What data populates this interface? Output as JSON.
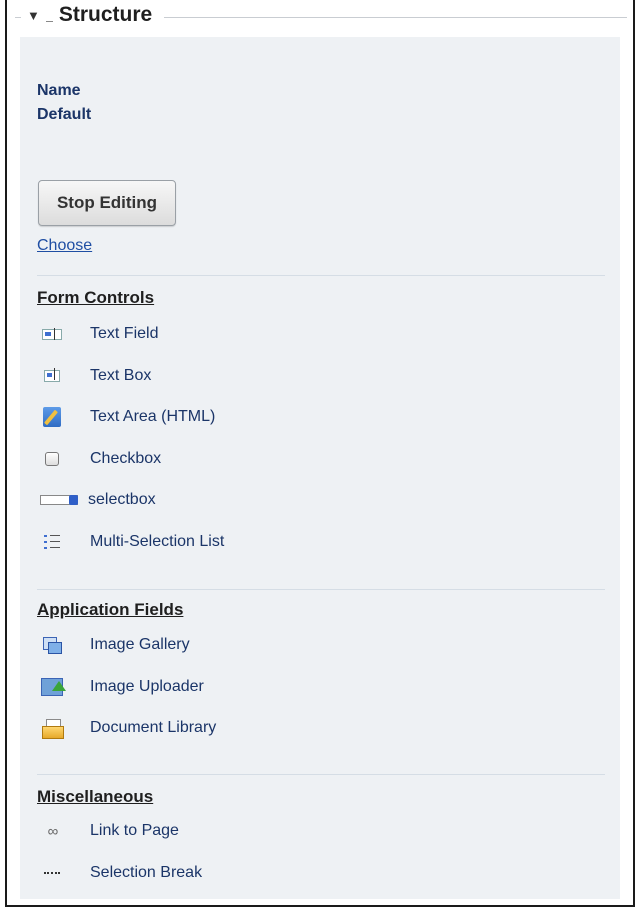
{
  "header": {
    "collapse_glyph": "▼",
    "title": "Structure"
  },
  "meta": {
    "name_label": "Name",
    "default_label": "Default"
  },
  "actions": {
    "stop_editing": "Stop Editing",
    "choose": "Choose"
  },
  "sections": {
    "form_controls": {
      "title": "Form Controls",
      "items": [
        {
          "label": "Text Field",
          "icon": "text-field-icon"
        },
        {
          "label": "Text Box",
          "icon": "text-box-icon"
        },
        {
          "label": "Text Area (HTML)",
          "icon": "text-area-icon"
        },
        {
          "label": "Checkbox",
          "icon": "checkbox-icon"
        },
        {
          "label": "selectbox",
          "icon": "selectbox-icon"
        },
        {
          "label": "Multi-Selection List",
          "icon": "multi-selection-list-icon"
        }
      ]
    },
    "application_fields": {
      "title": "Application Fields",
      "items": [
        {
          "label": "Image Gallery",
          "icon": "image-gallery-icon"
        },
        {
          "label": "Image Uploader",
          "icon": "image-uploader-icon"
        },
        {
          "label": "Document Library",
          "icon": "document-library-icon"
        }
      ]
    },
    "miscellaneous": {
      "title": "Miscellaneous",
      "items": [
        {
          "label": "Link to Page",
          "icon": "link-icon"
        },
        {
          "label": "Selection Break",
          "icon": "selection-break-icon"
        }
      ]
    }
  },
  "colors": {
    "panel_bg": "#eef1f4",
    "link": "#1f4ea3",
    "item_text": "#1b3568"
  }
}
